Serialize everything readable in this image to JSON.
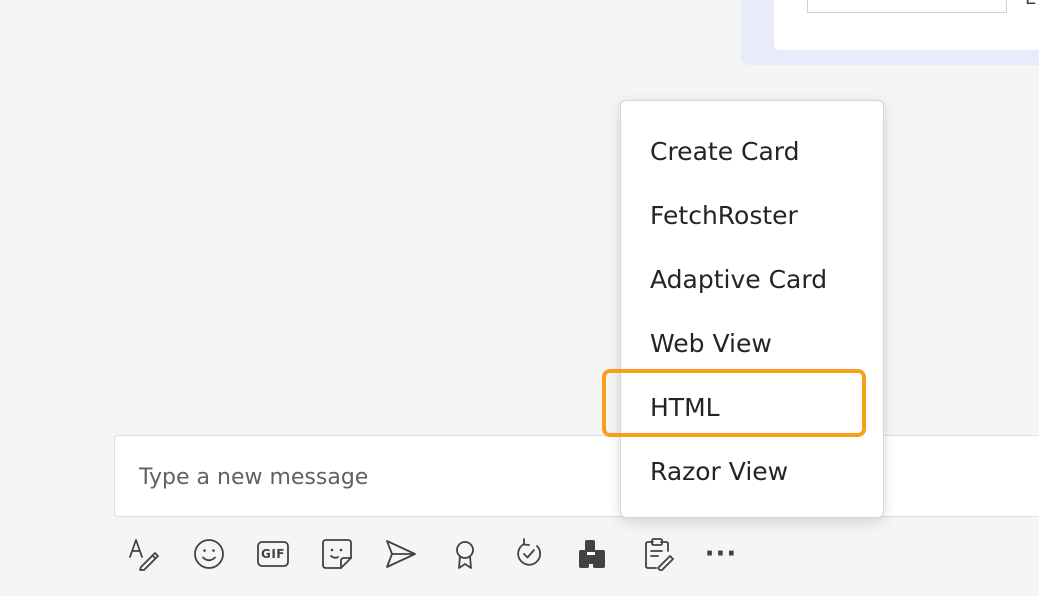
{
  "top_card": {
    "partial_text": "E"
  },
  "compose": {
    "placeholder": "Type a new message"
  },
  "command_menu": {
    "items": [
      {
        "label": "Create Card"
      },
      {
        "label": "FetchRoster"
      },
      {
        "label": "Adaptive Card"
      },
      {
        "label": "Web View"
      },
      {
        "label": "HTML"
      },
      {
        "label": "Razor View"
      }
    ],
    "highlighted_item": "HTML",
    "highlight_color": "#f7a11a"
  },
  "toolbar": {
    "icons": [
      "format-icon",
      "emoji-icon",
      "gif-icon",
      "sticker-icon",
      "schedule-send-icon",
      "praise-icon",
      "loop-icon",
      "apps-icon",
      "notes-icon",
      "more-options-icon"
    ],
    "gif_label": "GIF",
    "more_label": "···"
  }
}
